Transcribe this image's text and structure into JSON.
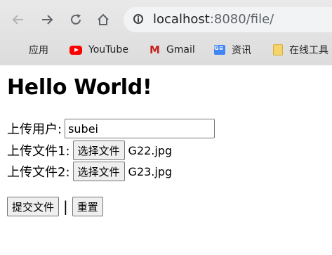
{
  "browser": {
    "url_host": "localhost",
    "url_path": ":8080/file/",
    "bookmarks": [
      {
        "label": "应用",
        "icon": "apps-grid-icon"
      },
      {
        "label": "YouTube",
        "icon": "youtube-icon"
      },
      {
        "label": "Gmail",
        "icon": "gmail-icon"
      },
      {
        "label": "资讯",
        "icon": "news-icon"
      },
      {
        "label": "在线工具",
        "icon": "folder-icon"
      }
    ]
  },
  "page": {
    "title": "Hello World!",
    "user_label": "上传用户:",
    "user_value": "subei",
    "file1_label": "上传文件1:",
    "file1_button": "选择文件",
    "file1_name": "G22.jpg",
    "file2_label": "上传文件2:",
    "file2_button": "选择文件",
    "file2_name": "G23.jpg",
    "submit_label": "提交文件",
    "separator": "|",
    "reset_label": "重置"
  }
}
